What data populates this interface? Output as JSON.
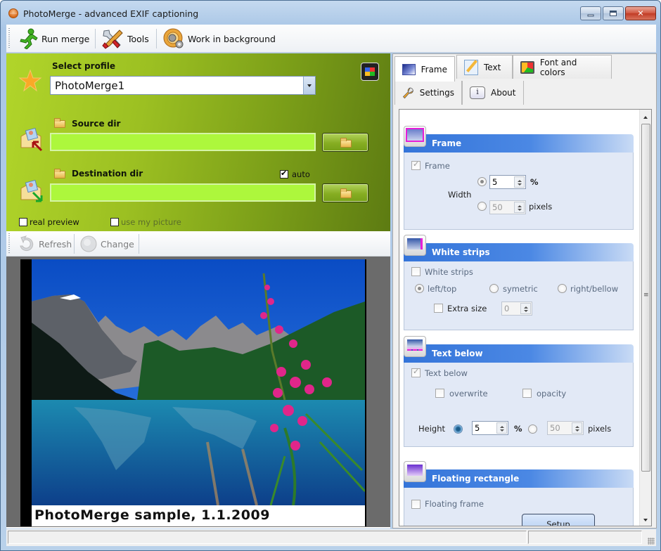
{
  "window": {
    "title": "PhotoMerge - advanced EXIF captioning",
    "controls": [
      "minimize",
      "maximize",
      "close"
    ]
  },
  "toolbar": {
    "items": [
      {
        "label": "Run merge",
        "icon": "running-man-icon"
      },
      {
        "label": "Tools",
        "icon": "tools-icon"
      },
      {
        "label": "Work in background",
        "icon": "gear-cd-icon"
      }
    ]
  },
  "profile": {
    "label": "Select profile",
    "value": "PhotoMerge1"
  },
  "source": {
    "label": "Source dir",
    "value": ""
  },
  "destination": {
    "label": "Destination dir",
    "value": "",
    "auto_label": "auto",
    "auto_checked": true
  },
  "options": {
    "real_preview": {
      "label": "real preview",
      "checked": false
    },
    "use_my_picture": {
      "label": "use my picture",
      "checked": false
    }
  },
  "preview_toolbar": {
    "refresh_label": "Refresh",
    "change_label": "Change"
  },
  "preview": {
    "caption": "PhotoMerge sample, 1.1.2009"
  },
  "tabs": [
    {
      "label": "Frame",
      "icon": "frame-icon",
      "active": true
    },
    {
      "label": "Text",
      "icon": "text-edit-icon",
      "active": false
    },
    {
      "label": "Font and colors",
      "icon": "font-colors-icon",
      "active": false
    },
    {
      "label": "Settings",
      "icon": "wrench-icon",
      "active": false
    },
    {
      "label": "About",
      "icon": "info-icon",
      "active": false
    }
  ],
  "frame_group": {
    "title": "Frame",
    "frame_label": "Frame",
    "frame_checked": true,
    "width_label": "Width",
    "percent_value": "5",
    "percent_unit": "%",
    "pixels_value": "50",
    "pixels_unit": "pixels",
    "selected_mode": "percent"
  },
  "white_strips_group": {
    "title": "White strips",
    "white_strips_label": "White strips",
    "white_strips_checked": false,
    "positions": [
      "left/top",
      "symetric",
      "right/bellow"
    ],
    "selected_position": "left/top",
    "extra_size_label": "Extra size",
    "extra_size_checked": false,
    "extra_size_value": "0"
  },
  "text_below_group": {
    "title": "Text below",
    "text_below_label": "Text below",
    "text_below_checked": true,
    "overwrite_label": "overwrite",
    "opacity_label": "opacity",
    "height_label": "Height",
    "percent_value": "5",
    "percent_unit": "%",
    "pixels_value": "50",
    "pixels_unit": "pixels",
    "selected_mode": "percent"
  },
  "floating_group": {
    "title": "Floating rectangle",
    "floating_frame_label": "Floating frame",
    "floating_frame_checked": false,
    "setup_label": "Setup"
  },
  "colors": {
    "green_panel": "#9cc022",
    "green_field": "#adf73c",
    "group_header": "#3474d9",
    "group_body": "#e2e9f6"
  }
}
